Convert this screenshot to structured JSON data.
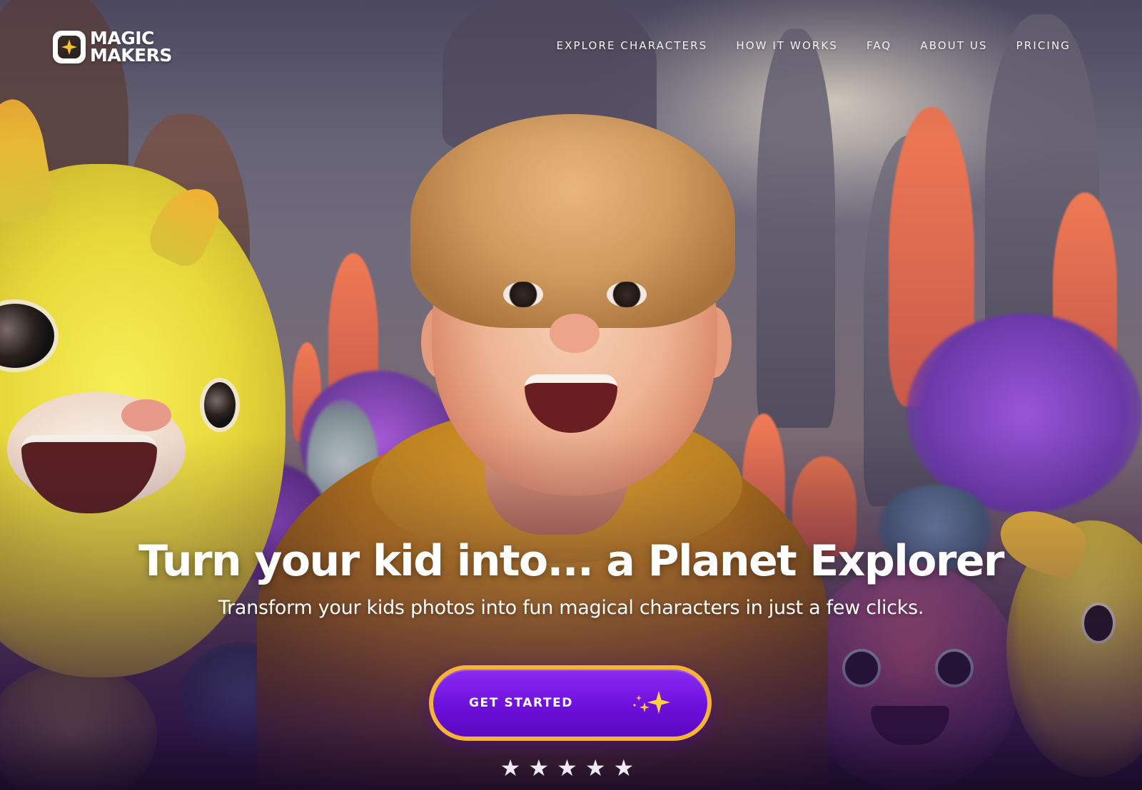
{
  "brand": {
    "name_line1": "MAGIC",
    "name_line2": "MAKERS",
    "logo_icon": "sparkle-icon",
    "accent_color": "#f5c12e"
  },
  "nav": {
    "items": [
      {
        "label": "EXPLORE CHARACTERS"
      },
      {
        "label": "HOW IT WORKS"
      },
      {
        "label": "FAQ"
      },
      {
        "label": "ABOUT US"
      },
      {
        "label": "PRICING"
      }
    ]
  },
  "hero": {
    "title": "Turn your kid into... a Planet Explorer",
    "subtitle": "Transform your kids photos into fun magical characters in just a few clicks.",
    "cta_label": "GET STARTED",
    "cta_icon": "sparkles-icon",
    "cta_color": "#6d10dc",
    "cta_border_color": "#f5b435",
    "rating_stars": "★★★★★",
    "rating_value": 5
  }
}
